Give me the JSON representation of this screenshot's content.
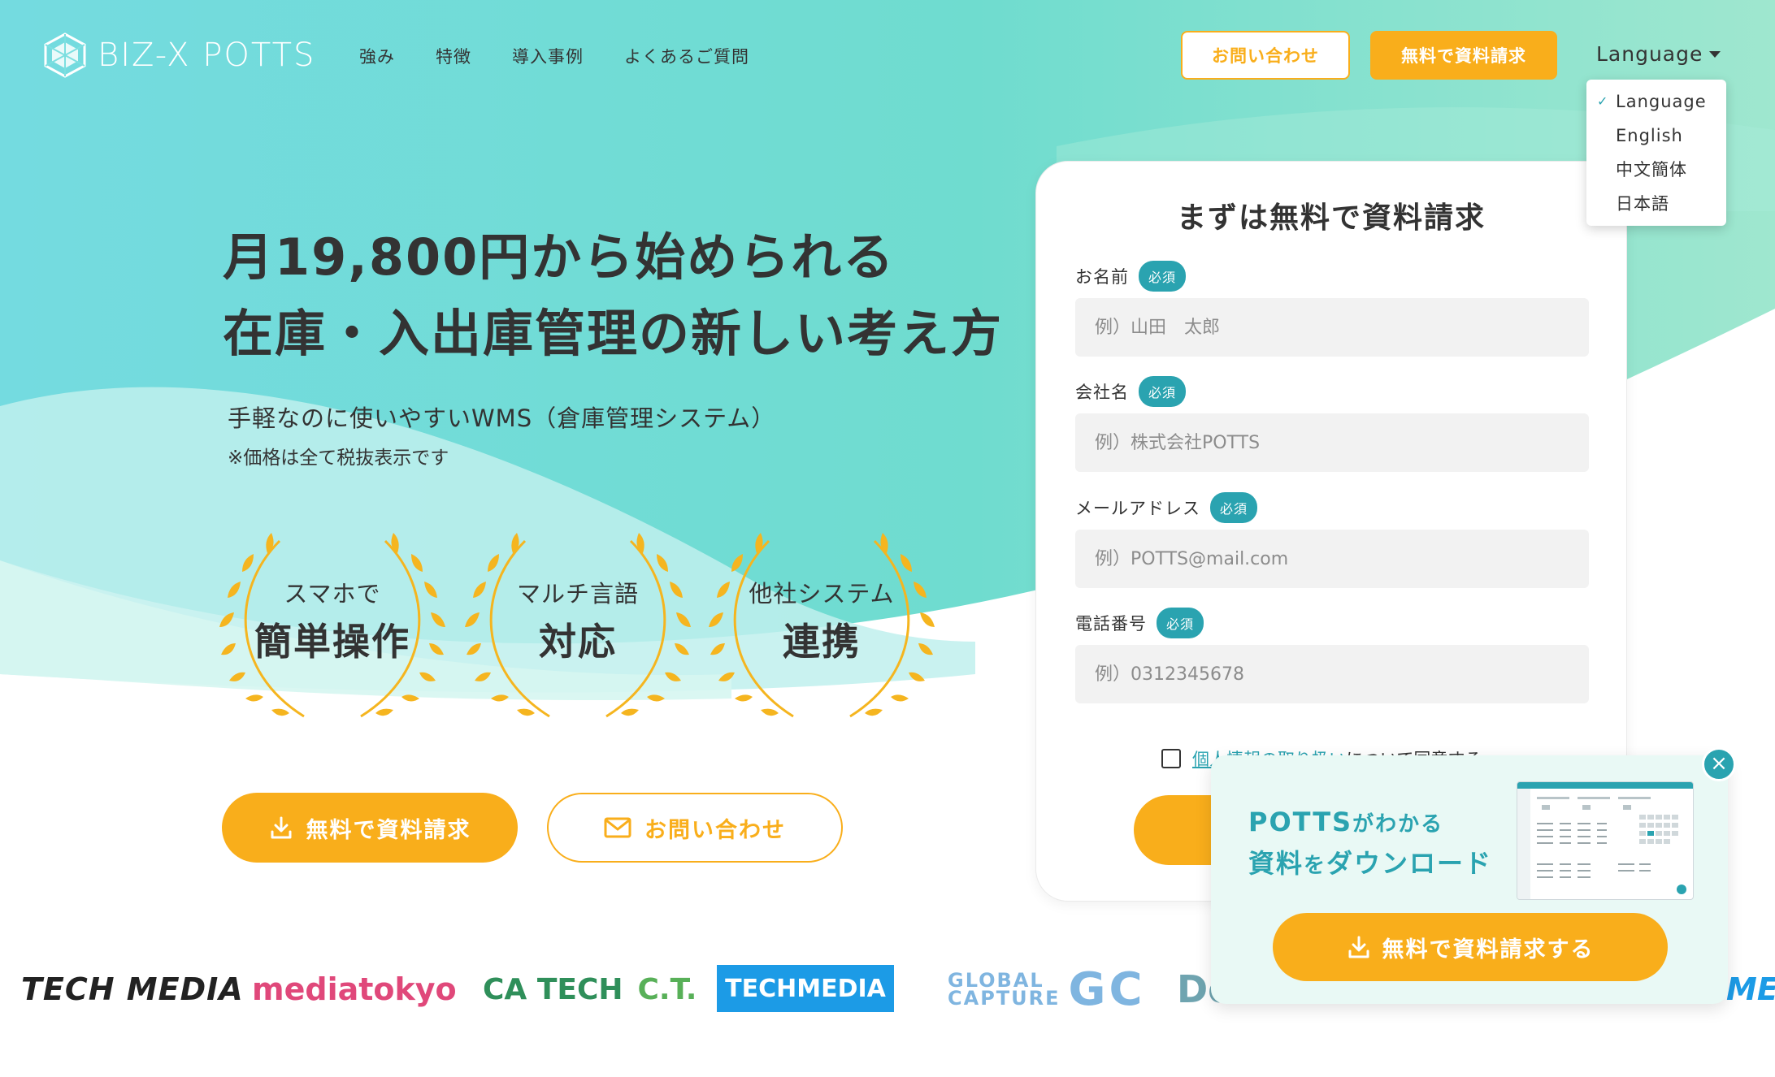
{
  "header": {
    "brand": "BIZ-X POTTS",
    "nav": [
      "強み",
      "特徴",
      "導入事例",
      "よくあるご質問"
    ],
    "contact_button": "お問い合わせ",
    "request_button": "無料で資料請求",
    "language_label": "Language",
    "language_options": [
      "Language",
      "English",
      "中文簡体",
      "日本語"
    ],
    "language_selected": "Language"
  },
  "hero": {
    "headline_1": "月19,800円から始められる",
    "headline_2": "在庫・入出庫管理の新しい考え方",
    "subline": "手軽なのに使いやすいWMS（倉庫管理システム）",
    "note": "※価格は全て税抜表示です",
    "badges": [
      {
        "top": "スマホで",
        "main": "簡単操作"
      },
      {
        "top": "マルチ言語",
        "main": "対応"
      },
      {
        "top": "他社システム",
        "main": "連携"
      }
    ],
    "cta_request": "無料で資料請求",
    "cta_contact": "お問い合わせ"
  },
  "form": {
    "title": "まずは無料で資料請求",
    "required_badge": "必須",
    "fields": [
      {
        "label": "お名前",
        "placeholder": "例）山田　太郎"
      },
      {
        "label": "会社名",
        "placeholder": "例）株式会社POTTS"
      },
      {
        "label": "メールアドレス",
        "placeholder": "例）POTTS@mail.com"
      },
      {
        "label": "電話番号",
        "placeholder": "例）0312345678"
      }
    ],
    "consent_link": "個人情報の取り扱い",
    "consent_text": "について同意する"
  },
  "popup": {
    "line1_main": "POTTS",
    "line1_sub": "がわかる",
    "line2_main": "資料",
    "line2_sub": "を",
    "line2_end": "ダウンロード",
    "button": "無料で資料請求する",
    "close_symbol": "×"
  },
  "logos": [
    "TECH MEDIA",
    "mediatokyo",
    "CA TECH",
    "C.T.",
    "TECHMEDIA",
    "GLOBAL",
    "CAPTURE",
    "GC",
    "Do",
    "ME"
  ],
  "colors": {
    "accent_orange": "#f9ae1b",
    "teal": "#2aa3b0",
    "hero_gradient_start": "#7ddfe0",
    "hero_gradient_end": "#a7ead4"
  }
}
